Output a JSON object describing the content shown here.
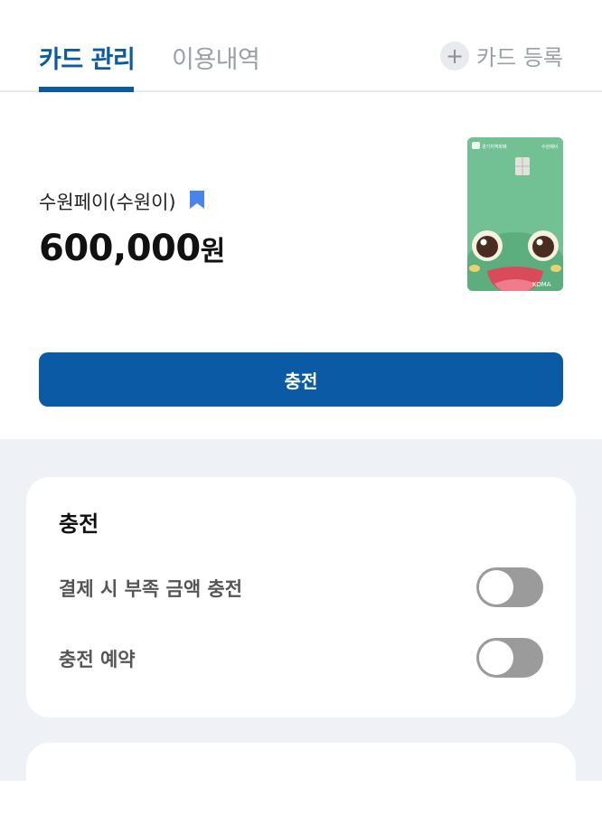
{
  "tabs": {
    "active_label": "카드 관리",
    "inactive_label": "이용내역",
    "register_label": "카드 등록",
    "register_icon": "plus-circle-icon"
  },
  "card": {
    "name": "수원페이(수원이)",
    "balance_amount": "600,000",
    "balance_unit": "원",
    "bookmark_color": "#4a84e8",
    "image_brand_text": "경기지역화폐",
    "image_local_text": "수원페이",
    "image_issuer_text": "KOMA"
  },
  "charge_button_label": "충전",
  "charge_panel": {
    "title": "충전",
    "settings": [
      {
        "label": "결제 시 부족 금액 충전",
        "enabled": false
      },
      {
        "label": "충전 예약",
        "enabled": false
      }
    ]
  },
  "colors": {
    "accent": "#0b5aa6",
    "toggle_off": "#9b9b9b",
    "background_grey": "#eef1f5"
  }
}
